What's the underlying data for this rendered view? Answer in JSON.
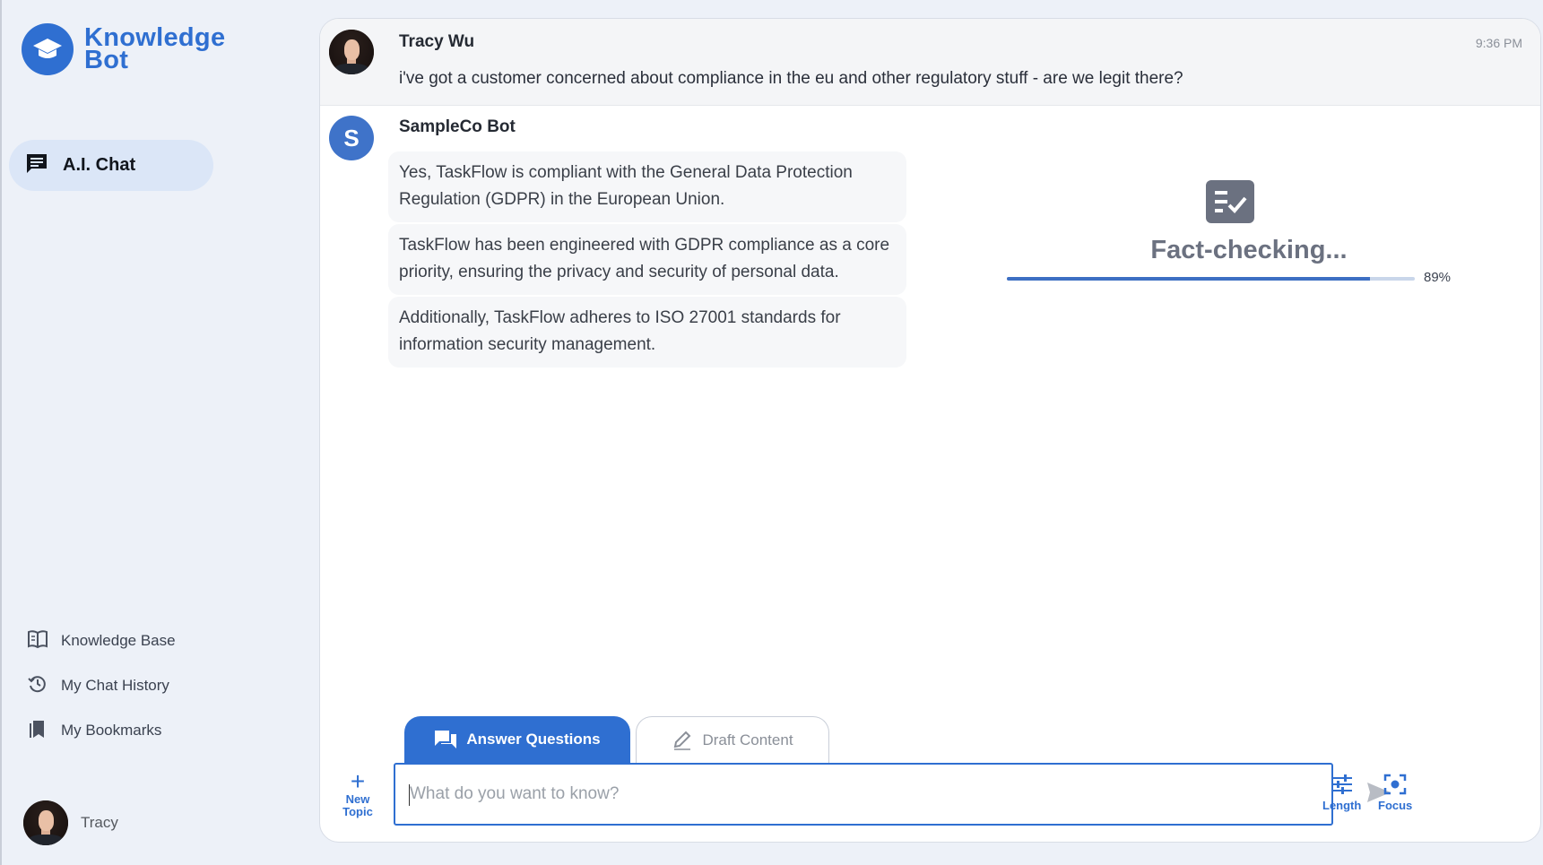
{
  "app": {
    "logo_line1": "Knowledge",
    "logo_line2": "Bot"
  },
  "sidebar": {
    "active": {
      "label": "A.I. Chat"
    },
    "items": [
      {
        "label": "Knowledge Base",
        "icon": "book-icon"
      },
      {
        "label": "My Chat History",
        "icon": "history-icon"
      },
      {
        "label": "My Bookmarks",
        "icon": "bookmark-icon"
      }
    ],
    "user": {
      "name": "Tracy"
    }
  },
  "chat": {
    "user_message": {
      "author": "Tracy Wu",
      "time": "9:36 PM",
      "text": "i've got a customer concerned about compliance in the eu and other regulatory stuff - are we legit there?"
    },
    "bot_message": {
      "author": "SampleCo Bot",
      "avatar_letter": "S",
      "paragraphs": [
        "Yes, TaskFlow is compliant with the General Data Protection Regulation (GDPR) in the European Union.",
        "TaskFlow has been engineered with GDPR compliance as a core priority, ensuring the privacy and security of personal data.",
        "Additionally, TaskFlow adheres to ISO 27001 standards for information security management."
      ]
    },
    "fact_check": {
      "title": "Fact-checking...",
      "progress_percent": 89,
      "progress_label": "89%"
    }
  },
  "composer": {
    "tabs": [
      {
        "label": "Answer Questions"
      },
      {
        "label": "Draft Content"
      }
    ],
    "new_topic": {
      "line1": "New",
      "line2": "Topic"
    },
    "placeholder": "What do you want to know?",
    "value": "",
    "tools": [
      {
        "label": "Length"
      },
      {
        "label": "Focus"
      }
    ]
  },
  "colors": {
    "accent": "#2f6fd1",
    "muted": "#6b7180",
    "progress_track": "#c9d6ea"
  }
}
